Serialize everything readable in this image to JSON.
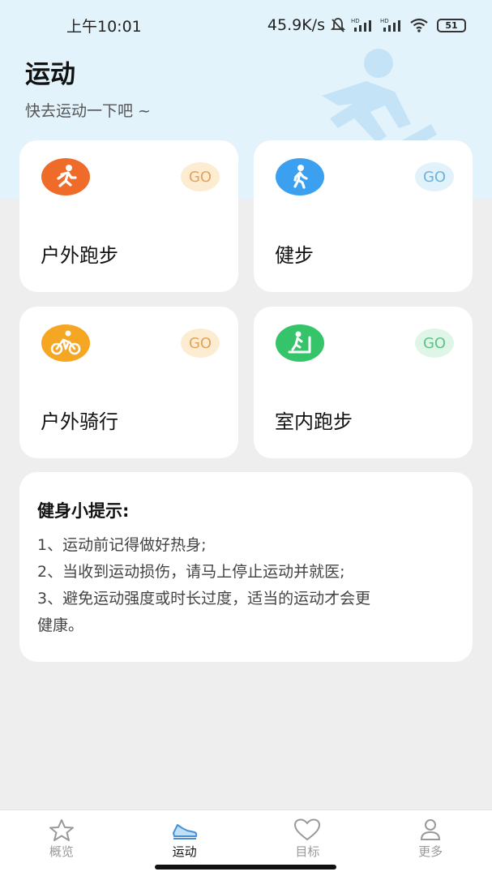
{
  "status_bar": {
    "time": "上午10:01",
    "network_speed": "45.9K/s",
    "battery": "51",
    "icons": [
      "mute-bell-icon",
      "hd-signal-icon",
      "hd-signal-icon",
      "wifi-icon",
      "battery-icon"
    ]
  },
  "header": {
    "title": "运动",
    "subtitle": "快去运动一下吧 ~"
  },
  "sports": [
    {
      "label": "户外跑步",
      "go": "GO",
      "icon": "running-icon",
      "icon_color": "#ee6b2a",
      "go_bg": "#fcecd2",
      "go_color": "#e4a35a"
    },
    {
      "label": "健步",
      "go": "GO",
      "icon": "walking-icon",
      "icon_color": "#3aa0ef",
      "go_bg": "#e1f2fb",
      "go_color": "#69b4e0"
    },
    {
      "label": "户外骑行",
      "go": "GO",
      "icon": "cycling-icon",
      "icon_color": "#f5a623",
      "go_bg": "#fcecd2",
      "go_color": "#e4a35a"
    },
    {
      "label": "室内跑步",
      "go": "GO",
      "icon": "treadmill-icon",
      "icon_color": "#36c46a",
      "go_bg": "#dff5e8",
      "go_color": "#5ec287"
    }
  ],
  "tips": {
    "title": "健身小提示:",
    "lines": [
      "1、运动前记得做好热身;",
      "2、当收到运动损伤，请马上停止运动并就医;",
      "3、避免运动强度或时长过度，适当的运动才会更",
      "健康。"
    ]
  },
  "nav": {
    "items": [
      {
        "label": "概览",
        "icon": "star-icon",
        "active": false
      },
      {
        "label": "运动",
        "icon": "sneaker-icon",
        "active": true
      },
      {
        "label": "目标",
        "icon": "heart-icon",
        "active": false
      },
      {
        "label": "更多",
        "icon": "person-icon",
        "active": false
      }
    ]
  }
}
